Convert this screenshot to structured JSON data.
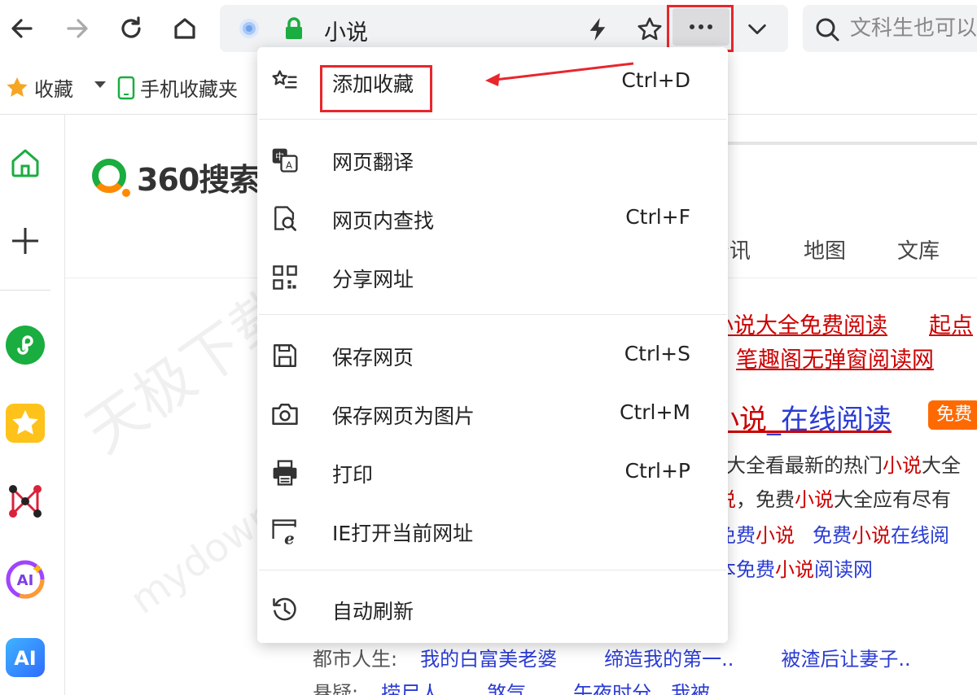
{
  "browser": {
    "address_text": "小说",
    "search_placeholder": "文科生也可以"
  },
  "bookmarks": [
    {
      "label": "收藏"
    },
    {
      "label": "手机收藏夹"
    }
  ],
  "page": {
    "logo_text": "360搜索",
    "tabs": [
      "资讯",
      "地图",
      "文库"
    ],
    "related_links": [
      "小说大全免费阅读",
      "起点",
      "笔趣阁无弹窗阅读网"
    ],
    "result_title_red": "小说",
    "result_title_blue": "_在线阅读",
    "badge": "免费",
    "snippet1_a": "大全看最新的热门",
    "snippet1_hl": "小说",
    "snippet1_b": "大全",
    "snippet2_hl1": "说",
    "snippet2_a": "，免费",
    "snippet2_hl2": "小说",
    "snippet2_b": "大全应有尽有",
    "sublinks_row1_a": "免费",
    "sublinks_row1_hl": "小说",
    "sublinks_row1_b": "免费",
    "sublinks_row1_hl2": "小说",
    "sublinks_row1_c": "在线阅",
    "sublinks_row2_a": "本免费",
    "sublinks_row2_hl": "小说",
    "sublinks_row2_b": "阅读网",
    "categories": [
      {
        "label": "都市人生:",
        "links": [
          "我的白富美老婆",
          "缔造我的第一..",
          "被渣后让妻子.."
        ]
      },
      {
        "label": "悬疑:",
        "links": [
          "捞尸人",
          "煞气",
          "午夜时分，我被.."
        ]
      }
    ]
  },
  "menu": {
    "items": [
      {
        "label": "添加收藏",
        "shortcut": "Ctrl+D",
        "icon": "star-list-icon"
      },
      {
        "label": "网页翻译",
        "shortcut": "",
        "icon": "translate-icon"
      },
      {
        "label": "网页内查找",
        "shortcut": "Ctrl+F",
        "icon": "find-in-page-icon"
      },
      {
        "label": "分享网址",
        "shortcut": "",
        "icon": "qr-code-icon"
      },
      {
        "label": "保存网页",
        "shortcut": "Ctrl+S",
        "icon": "save-icon"
      },
      {
        "label": "保存网页为图片",
        "shortcut": "Ctrl+M",
        "icon": "camera-icon"
      },
      {
        "label": "打印",
        "shortcut": "Ctrl+P",
        "icon": "printer-icon"
      },
      {
        "label": "IE打开当前网址",
        "shortcut": "",
        "icon": "ie-icon"
      },
      {
        "label": "自动刷新",
        "shortcut": "",
        "icon": "auto-refresh-icon"
      }
    ]
  },
  "watermark": {
    "line1": "天极下载站",
    "line2": "mydown.yesky.com"
  },
  "colors": {
    "annotation_red": "#e8262c",
    "link_blue": "#2a3bd4",
    "highlight_red": "#cc0000",
    "badge_orange": "#ff6a00"
  }
}
